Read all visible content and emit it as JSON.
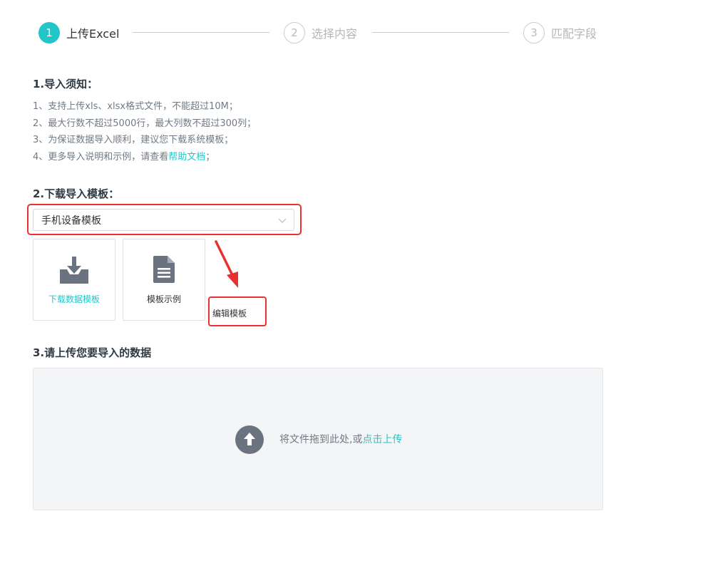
{
  "steps": [
    {
      "number": "1",
      "label": "上传Excel"
    },
    {
      "number": "2",
      "label": "选择内容"
    },
    {
      "number": "3",
      "label": "匹配字段"
    }
  ],
  "section1": {
    "title": "1.导入须知：",
    "items": [
      "1、支持上传xls、xlsx格式文件，不能超过10M；",
      "2、最大行数不超过5000行，最大列数不超过300列；",
      "3、为保证数据导入顺利，建议您下载系统模板；"
    ],
    "item4": {
      "prefix": "4、更多导入说明和示例，请查看",
      "link": "帮助文档",
      "suffix": "；"
    }
  },
  "section2": {
    "title": "2.下载导入模板：",
    "select_value": "手机设备模板",
    "cards": [
      {
        "label": "下载数据模板",
        "icon": "download-tray-icon"
      },
      {
        "label": "模板示例",
        "icon": "document-icon"
      }
    ],
    "edit_label": "编辑模板"
  },
  "section3": {
    "title": "3.请上传您要导入的数据",
    "upload_text": "将文件拖到此处,或",
    "upload_link": "点击上传"
  },
  "colors": {
    "accent": "#23c6c8",
    "highlight_red": "#e8322f",
    "icon_gray": "#6b7380"
  }
}
